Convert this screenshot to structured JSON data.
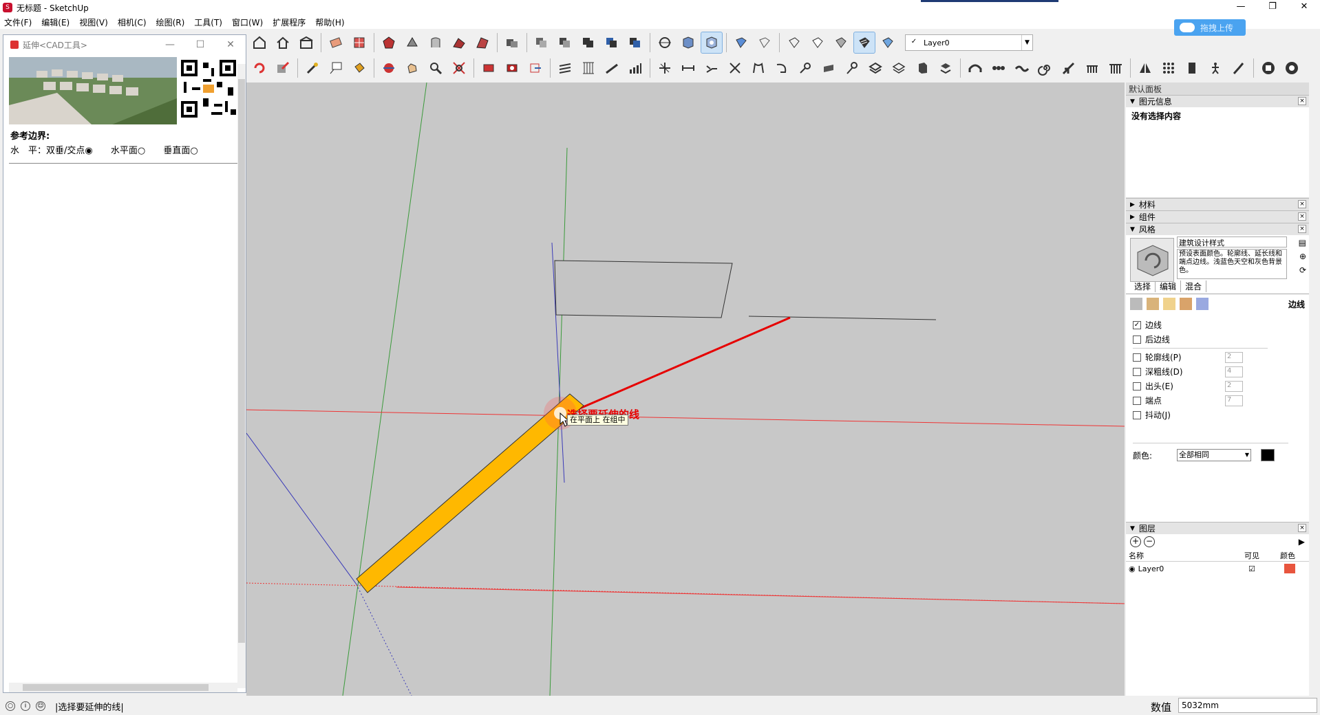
{
  "window": {
    "title": "无标题 - SketchUp",
    "app_icon": "sketchup-logo-icon"
  },
  "menubar": [
    "文件(F)",
    "编辑(E)",
    "视图(V)",
    "相机(C)",
    "绘图(R)",
    "工具(T)",
    "窗口(W)",
    "扩展程序",
    "帮助(H)"
  ],
  "toolbar": {
    "layer_check": "✓",
    "layer_name": "Layer0",
    "upload_label": "拖拽上传"
  },
  "cad_window": {
    "title": "延伸<CAD工具>",
    "options_title": "参考边界:",
    "options": [
      "水　平：双垂/交点◉",
      "水平面○",
      "垂直面○"
    ]
  },
  "viewport": {
    "hint_red": "选择要延伸的线",
    "hint_box": "在平面上 在组中"
  },
  "tray": {
    "title": "默认面板",
    "entity_info": {
      "label": "图元信息",
      "content": "没有选择内容"
    },
    "materials": "材料",
    "components": "组件",
    "styles": {
      "label": "风格",
      "name": "建筑设计样式",
      "description": "预设表面颜色。轮廓线、延长线和端点边线。浅蓝色天空和灰色背景色。",
      "tabs": [
        "选择",
        "编辑",
        "混合"
      ],
      "edge_settings_label": "边线",
      "edges": [
        {
          "label": "边线",
          "checked": true,
          "value": ""
        },
        {
          "label": "后边线",
          "checked": false,
          "value": ""
        },
        {
          "label": "轮廓线(P)",
          "checked": false,
          "value": "2"
        },
        {
          "label": "深粗线(D)",
          "checked": false,
          "value": "4"
        },
        {
          "label": "出头(E)",
          "checked": false,
          "value": "2"
        },
        {
          "label": "端点",
          "checked": false,
          "value": "7"
        },
        {
          "label": "抖动(J)",
          "checked": false,
          "value": ""
        }
      ],
      "color_label": "颜色:",
      "color_value": "全部相同",
      "color_swatch": "#000000"
    },
    "layers": {
      "label": "图层",
      "col_name": "名称",
      "col_visible": "可见",
      "col_color": "颜色",
      "rows": [
        {
          "name": "Layer0",
          "visible": "☑",
          "color": "#e8553e"
        }
      ]
    }
  },
  "statusbar": {
    "text": "选择要延伸的线",
    "measure_label": "数值",
    "measure_value": "5032mm"
  },
  "colors": {
    "viewport_bg": "#c8c8c8",
    "selected_fill": "#ffb800",
    "accent": "#4aa3f0"
  }
}
